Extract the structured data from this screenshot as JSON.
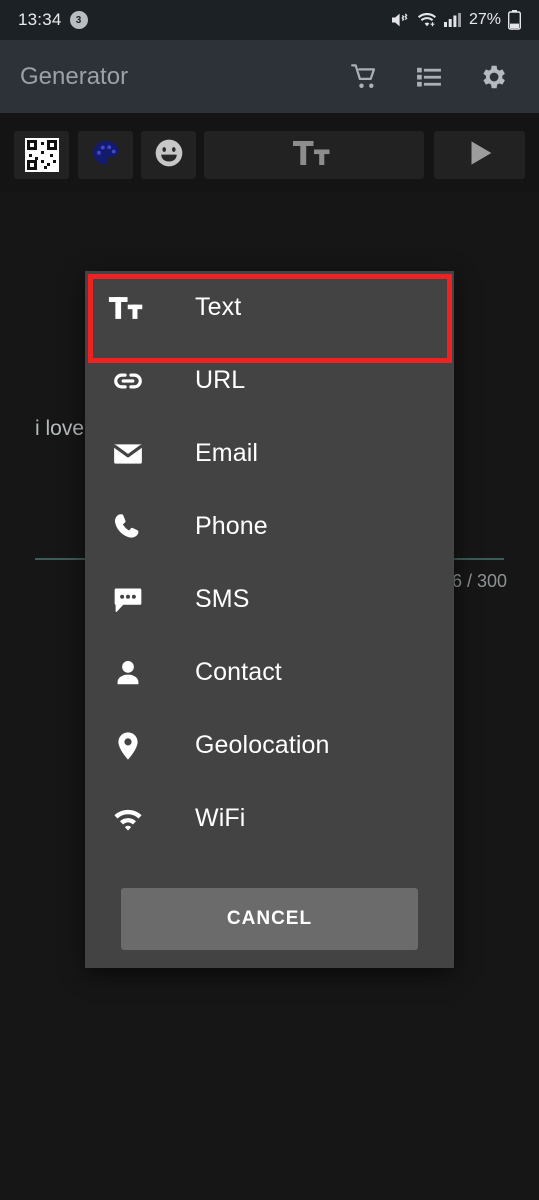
{
  "status_bar": {
    "time": "13:34",
    "notification_count": "3",
    "battery_percent": "27%",
    "icons": [
      "mute-icon",
      "wifi-icon",
      "signal-icon",
      "battery-icon"
    ]
  },
  "app_bar": {
    "title": "Generator",
    "actions": [
      {
        "name": "cart-icon"
      },
      {
        "name": "list-icon"
      },
      {
        "name": "gear-icon"
      }
    ]
  },
  "toolbar": {
    "buttons": [
      {
        "name": "qr-code-icon",
        "label": ""
      },
      {
        "name": "palette-icon",
        "label": ""
      },
      {
        "name": "emoji-icon",
        "label": ""
      },
      {
        "name": "text-format-icon",
        "label": "Tт"
      },
      {
        "name": "play-icon",
        "label": ""
      }
    ]
  },
  "editor": {
    "value": "i love u pặc pặc",
    "placeholder": "",
    "char_counter": "6 / 300"
  },
  "dialog": {
    "items": [
      {
        "label": "Text",
        "icon": "text-format-icon"
      },
      {
        "label": "URL",
        "icon": "link-icon"
      },
      {
        "label": "Email",
        "icon": "envelope-icon"
      },
      {
        "label": "Phone",
        "icon": "phone-icon"
      },
      {
        "label": "SMS",
        "icon": "chat-bubble-icon"
      },
      {
        "label": "Contact",
        "icon": "person-icon"
      },
      {
        "label": "Geolocation",
        "icon": "map-pin-icon"
      },
      {
        "label": "WiFi",
        "icon": "wifi-icon"
      }
    ],
    "cancel_label": "CANCEL",
    "highlighted_item": "Text"
  },
  "colors": {
    "highlight": "#ee2222",
    "dialog_bg": "#434343",
    "app_bar_bg": "#2c3238",
    "accent_underline": "#3d5b58",
    "palette_icon": "#141a6e"
  }
}
